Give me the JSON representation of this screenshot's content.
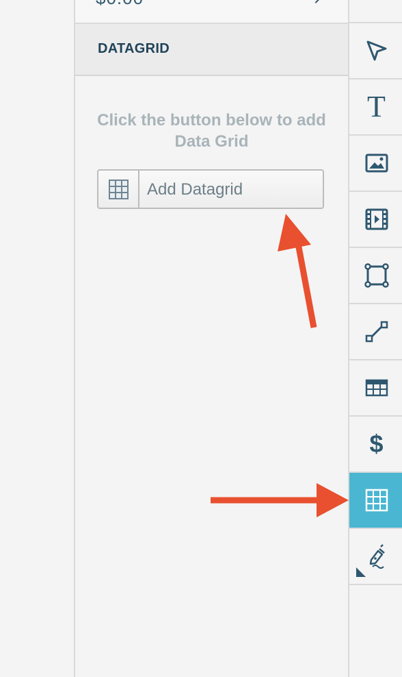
{
  "price_row": {
    "value": "$0.00"
  },
  "section": {
    "title": "DATAGRID"
  },
  "hint": {
    "text": "Click the button below to add Data Grid"
  },
  "add_button": {
    "label": "Add Datagrid",
    "icon": "grid-icon"
  },
  "toolbar": {
    "tools": [
      {
        "name": "select-tool",
        "icon": "cursor-arrow-icon"
      },
      {
        "name": "text-tool",
        "icon": "text-icon",
        "glyph": "T"
      },
      {
        "name": "image-tool",
        "icon": "image-icon"
      },
      {
        "name": "video-tool",
        "icon": "video-icon"
      },
      {
        "name": "shape-tool",
        "icon": "shape-icon"
      },
      {
        "name": "line-tool",
        "icon": "line-icon"
      },
      {
        "name": "table-tool",
        "icon": "table-icon"
      },
      {
        "name": "pricing-tool",
        "icon": "dollar-icon",
        "glyph": "$"
      },
      {
        "name": "datagrid-tool",
        "icon": "grid-icon",
        "active": true
      },
      {
        "name": "signature-tool",
        "icon": "pen-signature-icon"
      }
    ]
  },
  "colors": {
    "accent": "#4ab6d2",
    "annotation": "#e8502f",
    "icon": "#2f5870",
    "title": "#1f4258"
  }
}
